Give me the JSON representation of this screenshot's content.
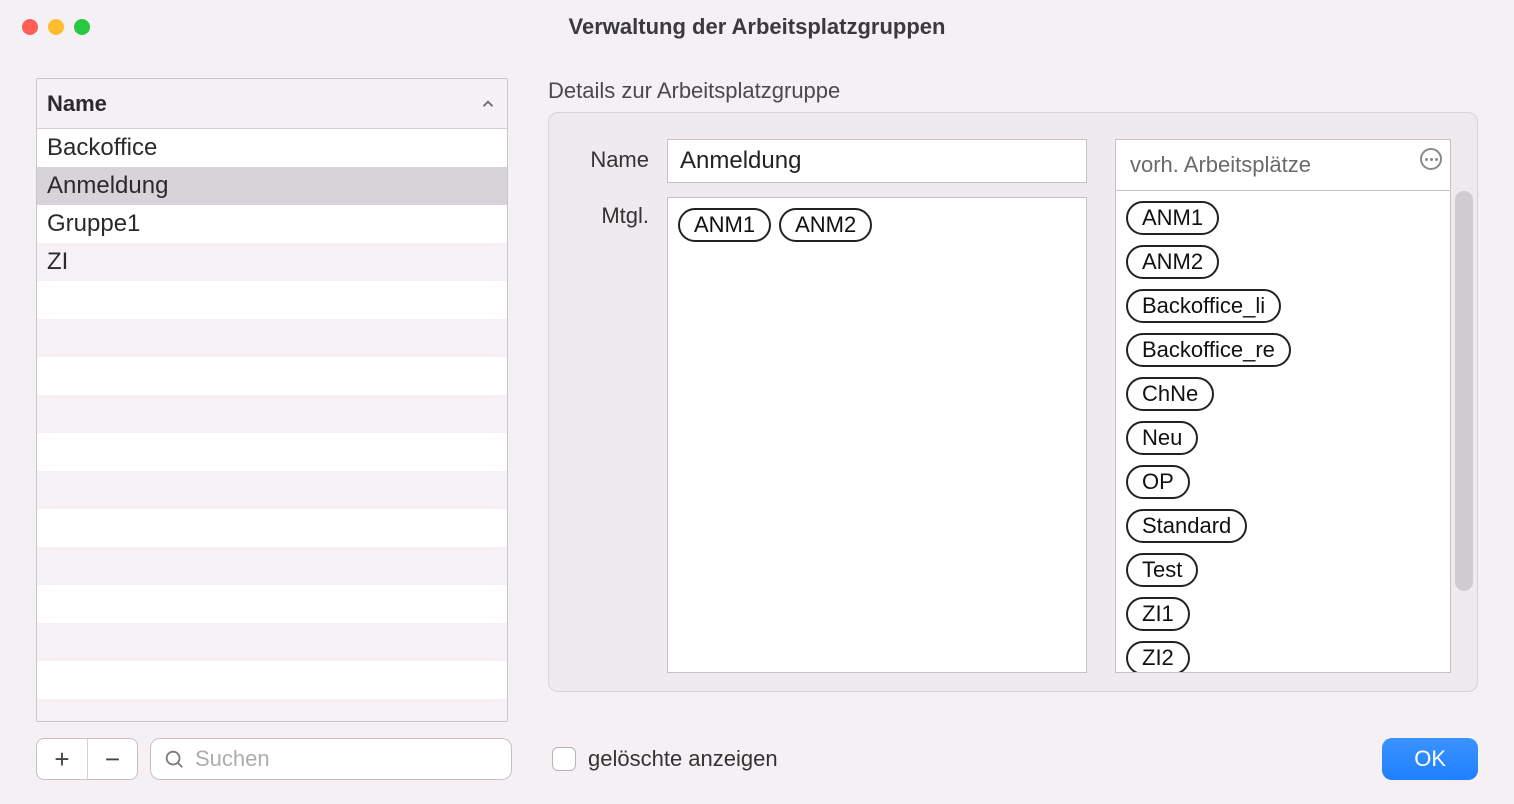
{
  "window": {
    "title": "Verwaltung der Arbeitsplatzgruppen"
  },
  "list": {
    "header": "Name",
    "items": [
      "Backoffice",
      "Anmeldung",
      "Gruppe1",
      "ZI"
    ],
    "selected_index": 1
  },
  "details": {
    "section_label": "Details zur Arbeitsplatzgruppe",
    "name_label": "Name",
    "name_value": "Anmeldung",
    "members_label": "Mtgl.",
    "members": [
      "ANM1",
      "ANM2"
    ]
  },
  "available": {
    "header": "vorh. Arbeitsplätze",
    "items": [
      "ANM1",
      "ANM2",
      "Backoffice_li",
      "Backoffice_re",
      "ChNe",
      "Neu",
      "OP",
      "Standard",
      "Test",
      "ZI1",
      "ZI2"
    ]
  },
  "footer": {
    "search_placeholder": "Suchen",
    "deleted_label": "gelöschte anzeigen",
    "ok_label": "OK"
  }
}
